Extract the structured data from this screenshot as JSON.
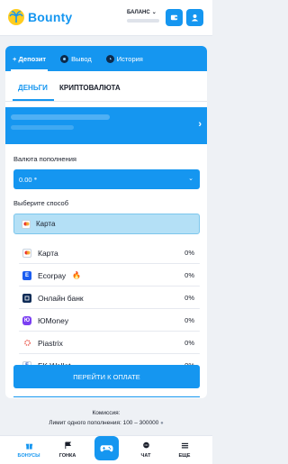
{
  "header": {
    "brand": "Bounty",
    "balance_label": "БАЛАНС",
    "wallet_icon": "wallet-icon",
    "user_icon": "user-icon"
  },
  "tabs": [
    {
      "label": "+ Депозит",
      "active": true
    },
    {
      "label": "Вывод",
      "active": false
    },
    {
      "label": "История",
      "active": false
    }
  ],
  "subtabs": [
    {
      "label": "ДЕНЬГИ",
      "active": true
    },
    {
      "label": "КРИПТОВАЛЮТА",
      "active": false
    }
  ],
  "form": {
    "currency_label": "Валюта пополнения",
    "amount_value": "0.00",
    "method_label": "Выберите способ",
    "selected_method": "Карта"
  },
  "methods": [
    {
      "name": "Карта",
      "percent": "0%",
      "icon": "card-icon"
    },
    {
      "name": "Ecorpay",
      "percent": "0%",
      "icon": "ecorpay-icon",
      "badge": "🔥"
    },
    {
      "name": "Онлайн банк",
      "percent": "0%",
      "icon": "bank-icon"
    },
    {
      "name": "ЮMoney",
      "percent": "0%",
      "icon": "yumoney-icon"
    },
    {
      "name": "Piastrix",
      "percent": "0%",
      "icon": "piastrix-icon"
    },
    {
      "name": "FK Wallet",
      "percent": "0%",
      "icon": "fkwallet-icon"
    }
  ],
  "pay_button": "ПЕРЕЙТИ К ОПЛАТЕ",
  "info": {
    "commission": "Комиссия:",
    "limit": "Лимит одного пополнения: 100 – 300000"
  },
  "bottom_nav": [
    {
      "label": "БОНУСЫ",
      "icon": "gift-icon"
    },
    {
      "label": "ГОНКА",
      "icon": "race-icon"
    },
    {
      "label": "ЧАТ",
      "icon": "chat-icon"
    },
    {
      "label": "ЕЩЕ",
      "icon": "more-icon"
    }
  ],
  "colors": {
    "accent": "#1596f0",
    "selected_bg": "#b4e0f6",
    "page_bg": "#eef1f5"
  }
}
